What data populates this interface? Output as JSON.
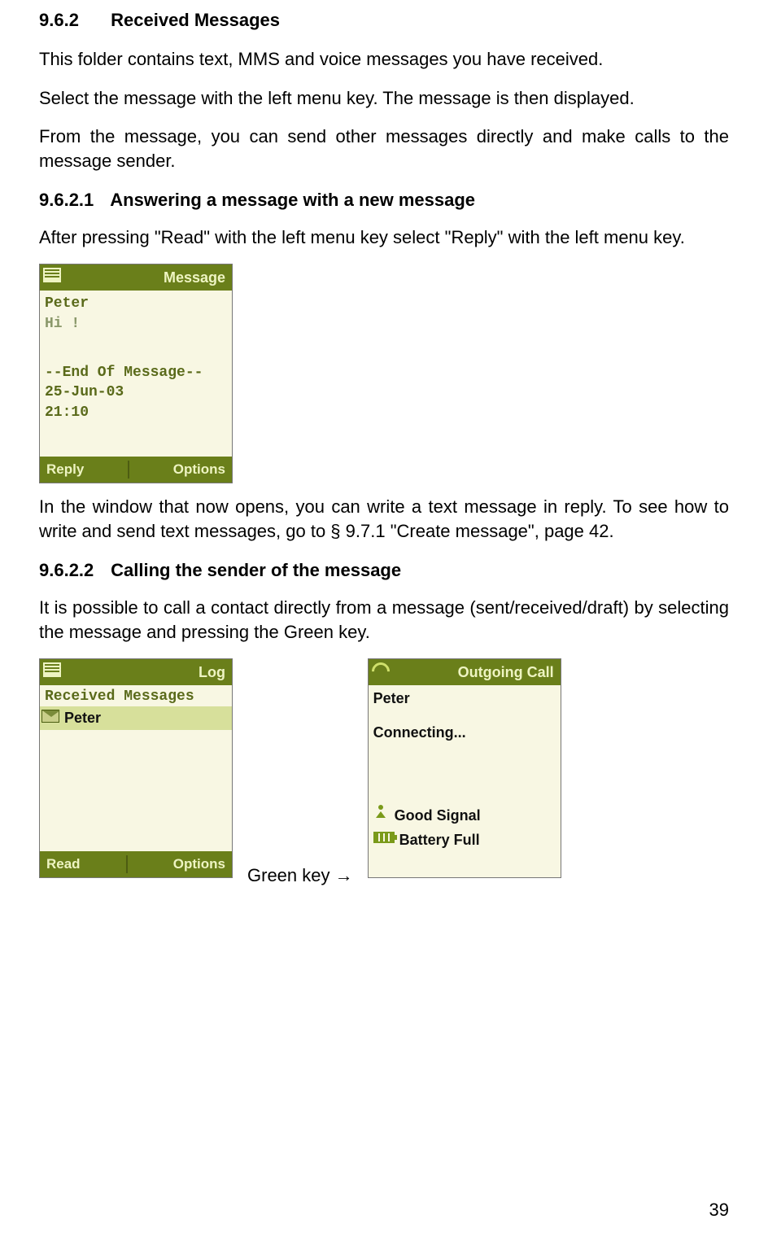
{
  "headings": {
    "h2_num": "9.6.2",
    "h2_title": "Received Messages",
    "h3a_num": "9.6.2.1",
    "h3a_title": "Answering a message with a new message",
    "h3b_num": "9.6.2.2",
    "h3b_title": "Calling the sender of the message"
  },
  "paragraphs": {
    "p1": "This folder contains text, MMS and voice messages you have received.",
    "p2": "Select the message with the left menu key. The message is then displayed.",
    "p3": "From the message, you can send other messages directly and make calls to the message sender.",
    "p4": "After pressing \"Read\" with the left menu key select \"Reply\" with the left menu key.",
    "p5": "In the window that now opens, you can write a text message in reply. To see how to write and send text messages, go to § 9.7.1 \"Create message\", page 42.",
    "p6": "It is possible to call a contact directly from a message (sent/received/draft) by selecting the message and pressing the Green key."
  },
  "screenshot1": {
    "title": "Message",
    "lines": {
      "sender": "Peter",
      "body": "Hi !",
      "end": "--End Of Message--",
      "date": "25-Jun-03",
      "time": "21:10"
    },
    "softkeys": {
      "left": "Reply",
      "right": "Options"
    }
  },
  "screenshot2": {
    "title": "Log",
    "subtitle": "Received Messages",
    "selected": "Peter",
    "softkeys": {
      "left": "Read",
      "right": "Options"
    }
  },
  "greenkey_label": "Green key →",
  "screenshot3": {
    "title": "Outgoing Call",
    "contact": "Peter",
    "status": "Connecting...",
    "signal": "Good Signal",
    "battery": "Battery Full"
  },
  "page_number": "39"
}
